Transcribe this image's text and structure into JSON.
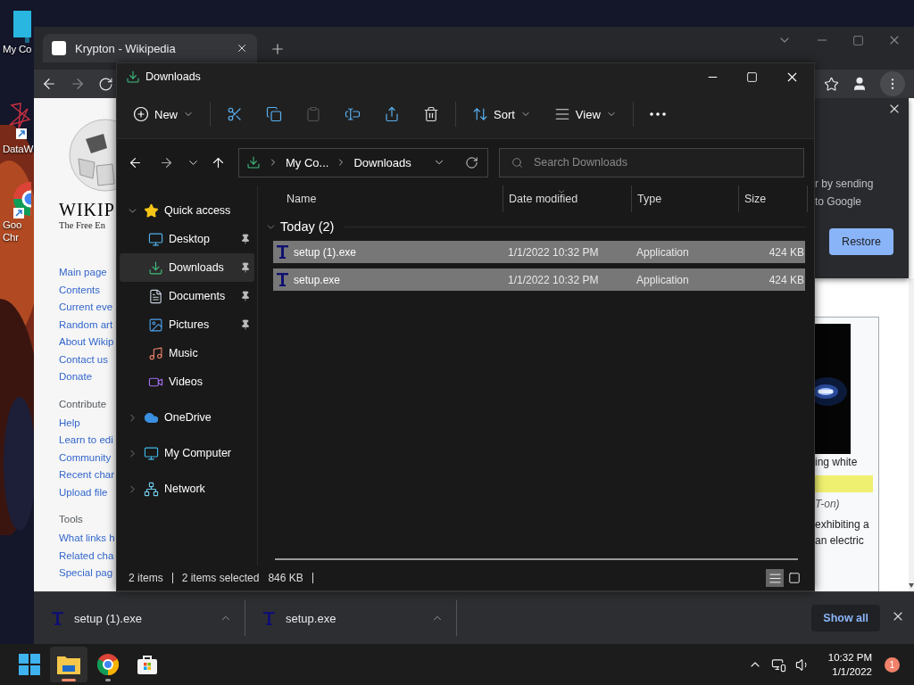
{
  "desktop_icons": [
    {
      "kind": "computer",
      "lines": [
        "My Co"
      ]
    },
    {
      "kind": "app",
      "lines": [
        "DataW"
      ]
    },
    {
      "kind": "chrome",
      "lines": [
        "Goo",
        "Chr"
      ]
    }
  ],
  "browser": {
    "tab": {
      "title": "Krypton - Wikipedia"
    },
    "sidebar": {
      "logo_title": "WIKIP",
      "logo_subtitle": "The Free En",
      "sections": [
        {
          "links": [
            "Main page",
            "Contents",
            "Current eve",
            "Random art",
            "About Wikip",
            "Contact us",
            "Donate"
          ]
        },
        {
          "heading": "Contribute",
          "links": [
            "Help",
            "Learn to edi",
            "Community",
            "Recent char",
            "Upload file"
          ]
        },
        {
          "heading": "Tools",
          "links": [
            "What links h",
            "Related cha",
            "Special pag"
          ]
        }
      ]
    },
    "download_bubble": {
      "lines": [
        "r by sending",
        "to Google"
      ],
      "button": "Restore"
    },
    "infobox": {
      "caption": "ing white",
      "pronunciation": "T-on)",
      "text_lines": [
        "exhibiting a",
        "an electric"
      ]
    },
    "download_shelf": {
      "items": [
        {
          "name": "setup (1).exe"
        },
        {
          "name": "setup.exe"
        }
      ],
      "show_all": "Show all"
    }
  },
  "explorer": {
    "title": "Downloads",
    "commands": [
      {
        "kind": "new",
        "label": "New",
        "disabled": false
      },
      {
        "kind": "cut",
        "disabled": false
      },
      {
        "kind": "copy",
        "disabled": false
      },
      {
        "kind": "paste",
        "disabled": true
      },
      {
        "kind": "rename",
        "disabled": false
      },
      {
        "kind": "share",
        "disabled": false
      },
      {
        "kind": "delete",
        "disabled": false
      },
      {
        "kind": "sort",
        "label": "Sort",
        "disabled": false
      },
      {
        "kind": "view",
        "label": "View",
        "disabled": false
      },
      {
        "kind": "more",
        "disabled": false
      }
    ],
    "address": {
      "crumbs": [
        "My Co...",
        "Downloads"
      ]
    },
    "search": {
      "placeholder": "Search Downloads"
    },
    "nav": [
      {
        "label": "Quick access",
        "kind": "star",
        "expanded": true,
        "selected": false,
        "children": [
          {
            "label": "Desktop",
            "kind": "desktop",
            "pinned": true,
            "selected": false
          },
          {
            "label": "Downloads",
            "kind": "download",
            "pinned": true,
            "selected": true
          },
          {
            "label": "Documents",
            "kind": "documents",
            "pinned": true,
            "selected": false
          },
          {
            "label": "Pictures",
            "kind": "pictures",
            "pinned": true,
            "selected": false
          },
          {
            "label": "Music",
            "kind": "music",
            "pinned": false,
            "selected": false
          },
          {
            "label": "Videos",
            "kind": "videos",
            "pinned": false,
            "selected": false
          }
        ]
      },
      {
        "label": "OneDrive",
        "kind": "cloud",
        "expanded": false,
        "selected": false
      },
      {
        "label": "My Computer",
        "kind": "computer",
        "expanded": false,
        "selected": false
      },
      {
        "label": "Network",
        "kind": "network",
        "expanded": false,
        "selected": false
      }
    ],
    "columns": [
      {
        "label": "Name",
        "sorted": false
      },
      {
        "label": "Date modified",
        "sorted": true
      },
      {
        "label": "Type",
        "sorted": false
      },
      {
        "label": "Size",
        "sorted": false
      }
    ],
    "groups": [
      {
        "label": "Today (2)",
        "expanded": true,
        "rows": [
          {
            "name": "setup (1).exe",
            "date": "1/1/2022 10:32 PM",
            "type": "Application",
            "size": "424 KB",
            "selected": true
          },
          {
            "name": "setup.exe",
            "date": "1/1/2022 10:32 PM",
            "type": "Application",
            "size": "424 KB",
            "selected": true
          }
        ]
      }
    ],
    "status": {
      "count": "2 items",
      "selection": "2 items selected",
      "size": "846 KB"
    },
    "views": [
      {
        "kind": "details",
        "selected": true
      },
      {
        "kind": "tiles",
        "selected": false
      }
    ]
  },
  "taskbar": {
    "apps": [
      {
        "kind": "start",
        "running": false,
        "active": false
      },
      {
        "kind": "explorer",
        "running": true,
        "active": true
      },
      {
        "kind": "chrome",
        "running": true,
        "active": false
      },
      {
        "kind": "store",
        "running": false,
        "active": false
      }
    ],
    "clock": {
      "time": "10:32 PM",
      "date": "1/1/2022"
    },
    "notifications": "1"
  }
}
